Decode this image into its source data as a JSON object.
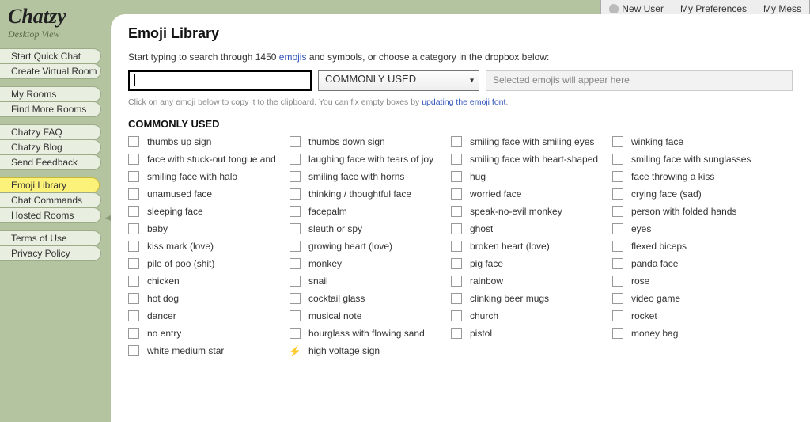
{
  "brand": "Chatzy",
  "subtitle": "Desktop View",
  "topbar": [
    {
      "label": "New User",
      "icon": "user-icon"
    },
    {
      "label": "My Preferences",
      "icon": null
    },
    {
      "label": "My Mess",
      "icon": null
    }
  ],
  "nav": [
    [
      {
        "label": "Start Quick Chat"
      },
      {
        "label": "Create Virtual Room"
      }
    ],
    [
      {
        "label": "My Rooms"
      },
      {
        "label": "Find More Rooms"
      }
    ],
    [
      {
        "label": "Chatzy FAQ"
      },
      {
        "label": "Chatzy Blog"
      },
      {
        "label": "Send Feedback"
      }
    ],
    [
      {
        "label": "Emoji Library",
        "active": true
      },
      {
        "label": "Chat Commands"
      },
      {
        "label": "Hosted Rooms"
      }
    ],
    [
      {
        "label": "Terms of Use"
      },
      {
        "label": "Privacy Policy"
      }
    ]
  ],
  "page": {
    "title": "Emoji Library",
    "intro_pre": "Start typing to search through 1450 ",
    "intro_link": "emojis",
    "intro_post": " and symbols, or choose a category in the dropbox below:",
    "search_value": "",
    "category": "COMMONLY USED",
    "selected_placeholder": "Selected emojis will appear here",
    "hint_pre": "Click on any emoji below to copy it to the clipboard. You can fix empty boxes by ",
    "hint_link": "updating the emoji font",
    "hint_post": ".",
    "section": "COMMONLY USED"
  },
  "emojis": [
    "thumbs up sign",
    "thumbs down sign",
    "smiling face with smiling eyes",
    "winking face",
    "face with stuck-out tongue and",
    "laughing face with tears of joy",
    "smiling face with heart-shaped",
    "smiling face with sunglasses",
    "smiling face with halo",
    "smiling face with horns",
    "hug",
    "face throwing a kiss",
    "unamused face",
    "thinking / thoughtful face",
    "worried face",
    "crying face (sad)",
    "sleeping face",
    "facepalm",
    "speak-no-evil monkey",
    "person with folded hands",
    "baby",
    "sleuth or spy",
    "ghost",
    "eyes",
    "kiss mark (love)",
    "growing heart (love)",
    "broken heart (love)",
    "flexed biceps",
    "pile of poo (shit)",
    "monkey",
    "pig face",
    "panda face",
    "chicken",
    "snail",
    "rainbow",
    "rose",
    "hot dog",
    "cocktail glass",
    "clinking beer mugs",
    "video game",
    "dancer",
    "musical note",
    "church",
    "rocket",
    "no entry",
    "hourglass with flowing sand",
    "pistol",
    "money bag",
    "white medium star",
    "high voltage sign"
  ],
  "emoji_glyphs": {
    "high voltage sign": "⚡"
  }
}
